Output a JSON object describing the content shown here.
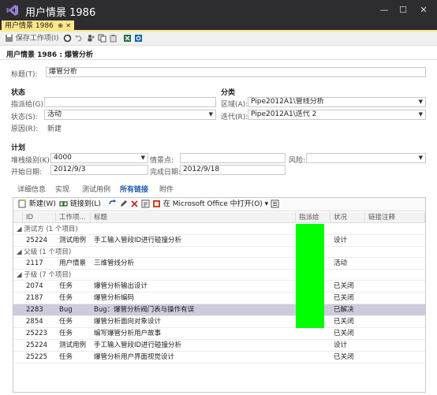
{
  "window": {
    "title": "用户情景 1986",
    "min": "—",
    "max": "☐",
    "close": "✕"
  },
  "doc_tab": {
    "label": "用户情景 1986",
    "pin": "⊕",
    "close": "✕"
  },
  "toolbar": {
    "save": "保存工作项(I)"
  },
  "breadcrumb": "用户情景 1986 : 爆管分析",
  "title_field": {
    "label": "标题(T):",
    "value": "爆管分析"
  },
  "status": {
    "header": "状态",
    "assigned": {
      "label": "指派给(G):",
      "value": ""
    },
    "state": {
      "label": "状态(S):",
      "value": "活动"
    },
    "reason": {
      "label": "原因(R):",
      "value": "新建"
    }
  },
  "classification": {
    "header": "分类",
    "area": {
      "label": "区域(A):",
      "value": "Pipe2012A1\\管线分析"
    },
    "iteration": {
      "label": "迭代(R):",
      "value": "Pipe2012A1\\迭代 2"
    }
  },
  "planning": {
    "header": "计划",
    "stack_rank": {
      "label": "堆栈级别(K):",
      "value": "4000"
    },
    "story_points": {
      "label": "情景点:",
      "value": ""
    },
    "risk": {
      "label": "风险:",
      "value": ""
    },
    "start_date": {
      "label": "开始日期:",
      "value": "2012/9/3"
    },
    "finish_date": {
      "label": "完成日期:",
      "value": "2012/9/18"
    }
  },
  "tabs": [
    "详细信息",
    "实现",
    "测试用例",
    "所有链接",
    "附件"
  ],
  "links_toolbar": {
    "new": "新建(W)",
    "link_to": "链接到(L)",
    "open_office": "在 Microsoft Office 中打开(O)"
  },
  "columns": [
    "ID",
    "工作项...",
    "标题",
    "指派给",
    "状况",
    "链接注释"
  ],
  "groups": [
    {
      "label": "测试方 (1 个项目)",
      "rows": [
        {
          "id": "25224",
          "type": "测试用例",
          "title": "手工输入管段ID进行碰撞分析",
          "state": "设计"
        }
      ]
    },
    {
      "label": "父级 (1 个项目)",
      "rows": [
        {
          "id": "2117",
          "type": "用户情景",
          "title": "三维管线分析",
          "state": "活动"
        }
      ]
    },
    {
      "label": "子级 (7 个项目)",
      "rows": [
        {
          "id": "2074",
          "type": "任务",
          "title": "爆管分析输出设计",
          "state": "已关闭"
        },
        {
          "id": "2187",
          "type": "任务",
          "title": "爆管分析编码",
          "state": "已关闭"
        },
        {
          "id": "2283",
          "type": "Bug",
          "title": "Bug：爆管分析阀门表与操作有误",
          "state": "已解决",
          "selected": true
        },
        {
          "id": "2854",
          "type": "任务",
          "title": "爆管分析面向对象设计",
          "state": "已关闭"
        },
        {
          "id": "25223",
          "type": "任务",
          "title": "编写爆管分析用户故事",
          "state": "已关闭"
        },
        {
          "id": "25224",
          "type": "测试用例",
          "title": "手工输入管段ID进行碰撞分析",
          "state": "设计"
        },
        {
          "id": "25225",
          "type": "任务",
          "title": "爆管分析用户界面视觉设计",
          "state": "已关闭"
        }
      ]
    }
  ],
  "colors": {
    "tab_accent": "#fce889",
    "title_bg": "#2d2d30",
    "highlight": "#00ff00",
    "selected_row": "#ccccdd",
    "active_tab": "#1e5aa8"
  }
}
